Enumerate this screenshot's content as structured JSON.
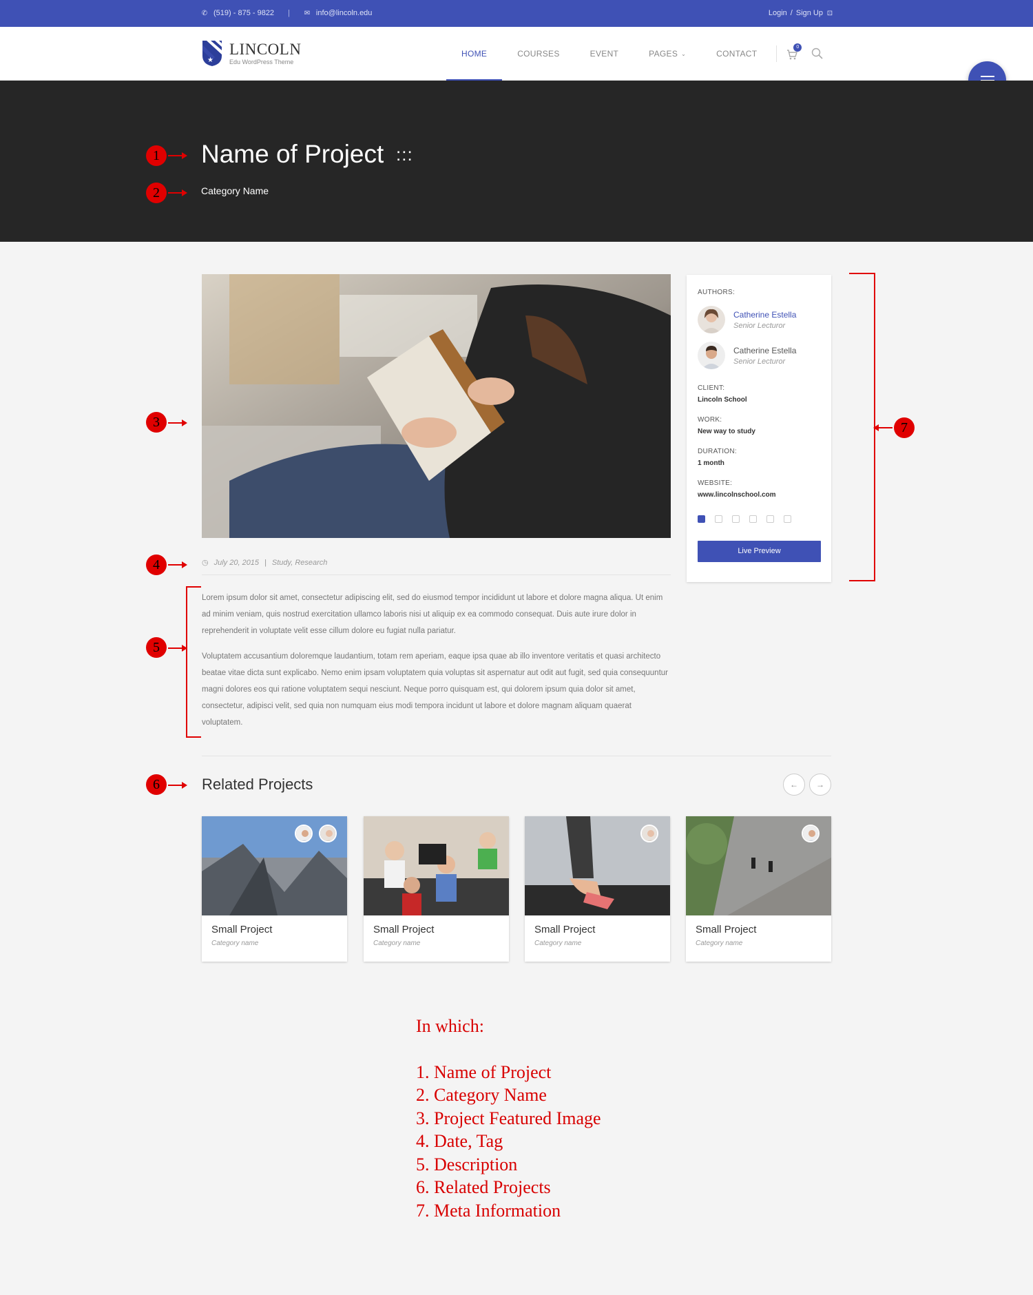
{
  "topbar": {
    "phone": "(519) - 875 - 9822",
    "email": "info@lincoln.edu",
    "login": "Login",
    "slash": "/",
    "signup": "Sign Up"
  },
  "logo": {
    "title": "LINCOLN",
    "subtitle": "Edu WordPress Theme"
  },
  "nav": {
    "items": [
      {
        "label": "HOME"
      },
      {
        "label": "COURSES"
      },
      {
        "label": "EVENT"
      },
      {
        "label": "PAGES"
      },
      {
        "label": "CONTACT"
      }
    ],
    "cart_count": "0"
  },
  "hero": {
    "title": "Name of Project",
    "dots": ":::",
    "category": "Category Name"
  },
  "markers": [
    "1",
    "2",
    "3",
    "4",
    "5",
    "6",
    "7"
  ],
  "post": {
    "date": "July 20, 2015",
    "sep": "|",
    "tags": "Study, Research",
    "paragraphs": [
      "Lorem ipsum dolor sit amet, consectetur adipiscing elit, sed do eiusmod tempor incididunt ut labore et dolore magna aliqua. Ut enim ad minim veniam, quis nostrud exercitation ullamco laboris nisi ut aliquip ex ea commodo consequat. Duis aute irure dolor in reprehenderit in voluptate velit esse cillum dolore eu fugiat nulla pariatur.",
      "Voluptatem accusantium doloremque laudantium, totam rem aperiam, eaque ipsa quae ab illo inventore veritatis et quasi architecto beatae vitae dicta sunt explicabo. Nemo enim ipsam voluptatem quia voluptas sit aspernatur aut odit aut fugit, sed quia consequuntur magni dolores eos qui ratione voluptatem sequi nesciunt. Neque porro quisquam est, qui dolorem ipsum quia dolor sit amet, consectetur, adipisci velit, sed quia non numquam eius modi tempora incidunt ut labore et dolore magnam aliquam quaerat voluptatem."
    ]
  },
  "sidebar": {
    "authors_label": "AUTHORS:",
    "authors": [
      {
        "name": "Catherine Estella",
        "role": "Senior Lecturor"
      },
      {
        "name": "Catherine Estella",
        "role": "Senior Lecturor"
      }
    ],
    "client_label": "CLIENT:",
    "client": "Lincoln School",
    "work_label": "WORK:",
    "work": "New way to study",
    "duration_label": "DURATION:",
    "duration": "1 month",
    "website_label": "WEBSITE:",
    "website": "www.lincolnschool.com",
    "social": [
      "twitter-icon",
      "facebook-icon",
      "google-plus-icon",
      "linkedin-icon",
      "pinterest-icon",
      "instagram-icon"
    ],
    "button": "Live Preview"
  },
  "related": {
    "title": "Related Projects",
    "prev": "←",
    "next": "→",
    "cards": [
      {
        "title": "Small Project",
        "category": "Category name"
      },
      {
        "title": "Small Project",
        "category": "Category name"
      },
      {
        "title": "Small Project",
        "category": "Category name"
      },
      {
        "title": "Small Project",
        "category": "Category name"
      }
    ]
  },
  "legend": {
    "heading": "In which:",
    "items": [
      "1. Name of Project",
      "2. Category Name",
      "3. Project Featured Image",
      "4. Date, Tag",
      "5. Description",
      "6. Related Projects",
      "7. Meta Information"
    ]
  },
  "colors": {
    "accent": "#3f51b5",
    "hero_bg": "#262626",
    "annotation": "#e00000"
  }
}
